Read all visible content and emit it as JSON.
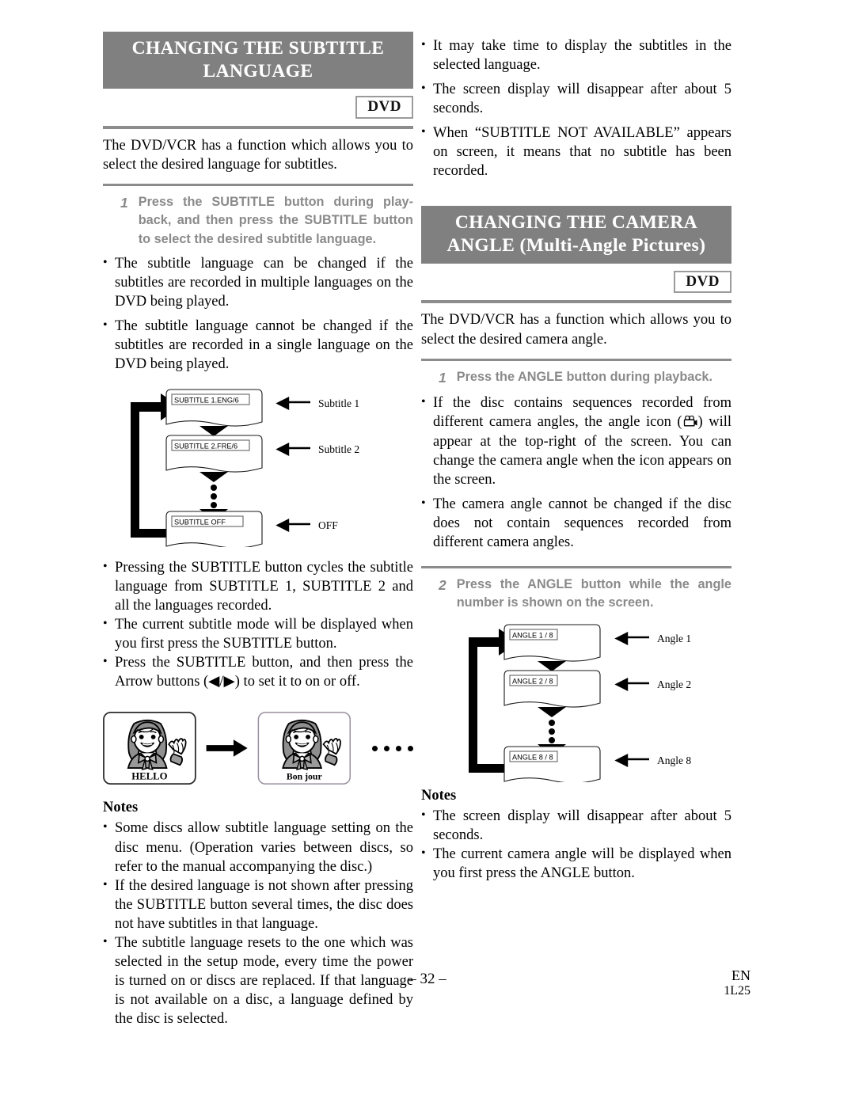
{
  "page": {
    "number_label": "– 32 –",
    "lang_code": "EN",
    "doc_code": "1L25"
  },
  "left_column": {
    "heading_line1": "CHANGING THE SUBTITLE",
    "heading_line2": "LANGUAGE",
    "badge": "DVD",
    "intro": "The DVD/VCR has a function which allows you to select the desired language for subtitles.",
    "step": {
      "number": "1",
      "text": "Press the SUBTITLE button during play-back, and then press the SUBTITLE button to select the desired subtitle language."
    },
    "bullets_top": [
      "The subtitle language can be changed if the subtitles are recorded in multiple languages on the DVD being played.",
      "The subtitle language cannot be changed if the subtitles are recorded in a single language on the DVD being played."
    ],
    "diagram": {
      "screens": [
        {
          "osd": "SUBTITLE 1.ENG/6",
          "callout": "Subtitle 1"
        },
        {
          "osd": "SUBTITLE 2.FRE/6",
          "callout": "Subtitle 2"
        },
        {
          "osd": "SUBTITLE OFF",
          "callout": "OFF"
        }
      ]
    },
    "bullets_mid": [
      "Pressing the SUBTITLE button cycles the subtitle language from SUBTITLE 1, SUBTITLE 2 and all the languages recorded.",
      "The current subtitle mode will be displayed when you first press the SUBTITLE button.",
      "Press the SUBTITLE button, and then press the Arrow buttons (◀/▶) to set it to on or off."
    ],
    "illustration": {
      "panel1_caption": "HELLO",
      "panel2_caption": "Bon jour"
    },
    "notes_heading": "Notes",
    "notes": [
      "Some discs allow subtitle language setting on the disc menu. (Operation varies between discs, so refer to the manual accompanying the disc.)",
      "If the desired language is not shown after pressing the SUBTITLE button several times, the disc does not have subtitles in that language.",
      "The subtitle language resets to the one which was selected in the setup mode, every time the power is turned on or discs are replaced. If that language is not available on a disc, a language defined by the disc is selected."
    ]
  },
  "right_column": {
    "bullets_top": [
      "It may take time to display the subtitles in the selected language.",
      "The screen display will disappear after about 5 seconds.",
      "When “SUBTITLE NOT AVAILABLE” appears on screen, it means that no subtitle has been recorded."
    ],
    "heading_line1": "CHANGING THE CAMERA",
    "heading_line2": "ANGLE (Multi-Angle Pictures)",
    "badge": "DVD",
    "intro": "The DVD/VCR has a function which allows you to select the desired camera angle.",
    "step1": {
      "number": "1",
      "text": "Press the ANGLE button during playback."
    },
    "bullets_mid_a": "If the disc contains sequences recorded from different camera angles, the angle icon (",
    "bullets_mid_a_end": ") will appear at the top-right of the screen. You can change the camera angle when the icon appears on the screen.",
    "bullets_mid_b": "The camera angle cannot be changed if the disc does not contain sequences recorded from different camera angles.",
    "step2": {
      "number": "2",
      "text": "Press the ANGLE button while the angle number is shown on the screen."
    },
    "diagram": {
      "screens": [
        {
          "osd": "ANGLE  1 / 8",
          "callout": "Angle 1"
        },
        {
          "osd": "ANGLE  2 / 8",
          "callout": "Angle 2"
        },
        {
          "osd": "ANGLE  8 / 8",
          "callout": "Angle 8"
        }
      ]
    },
    "notes_heading": "Notes",
    "notes": [
      "The screen display will disappear after about 5 seconds.",
      "The current camera angle will be displayed when you first press the ANGLE button."
    ]
  },
  "colors": {
    "banner_bg": "#808080",
    "rule": "#8c8c8c",
    "step_text": "#8a8a8a",
    "ink": "#000000"
  }
}
